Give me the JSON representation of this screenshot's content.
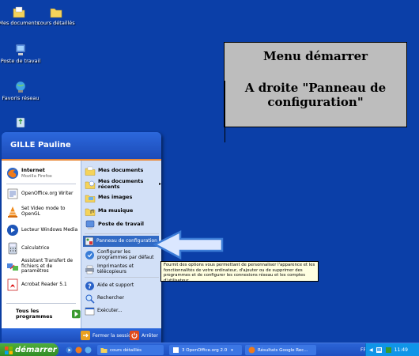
{
  "desktop": {
    "icons": [
      {
        "label": "Mes documents"
      },
      {
        "label": "cours détaillés"
      },
      {
        "label": "Poste de travail"
      },
      {
        "label": "Favoris réseau"
      }
    ]
  },
  "annotation": {
    "line1": "Menu démarrer",
    "line2": "A droite \"Panneau de configuration\""
  },
  "start_menu": {
    "user": "GILLE Pauline",
    "pinned": [
      {
        "title": "Internet",
        "subtitle": "Mozilla Firefox"
      }
    ],
    "recent": [
      {
        "label": "OpenOffice.org Writer"
      },
      {
        "label": "Set Video mode to OpenGL"
      },
      {
        "label": "Lecteur Windows Media"
      },
      {
        "label": "Calculatrice"
      },
      {
        "label": "Assistant Transfert de fichiers et de paramètres"
      },
      {
        "label": "Acrobat Reader 5.1"
      }
    ],
    "all_programs": "Tous les programmes",
    "right": {
      "mes_documents": "Mes documents",
      "documents_recents": "Mes documents récents",
      "mes_images": "Mes images",
      "ma_musique": "Ma musique",
      "poste_de_travail": "Poste de travail",
      "panneau": "Panneau de configuration",
      "configurer": "Configurer les programmes par défaut",
      "imprimantes": "Imprimantes et télécopieurs",
      "aide": "Aide et support",
      "rechercher": "Rechercher",
      "executer": "Exécuter..."
    },
    "footer": {
      "logoff": "Fermer la session",
      "shutdown": "Arrêter"
    }
  },
  "tooltip": "Fournit des options vous permettant de personnaliser l'apparence et les fonctionnalités de votre ordinateur, d'ajouter ou de supprimer des programmes et de configurer les connexions réseau et les comptes d'utilisateur.",
  "taskbar": {
    "start_label": "démarrer",
    "tasks": [
      {
        "label": "cours détaillés"
      },
      {
        "label": "3 OpenOffice.org 2.0"
      },
      {
        "label": "Résultats Google Rec..."
      }
    ],
    "lang": "FR",
    "clock": "11:49"
  },
  "colors": {
    "desktop": "#0b3fa8",
    "menu_blue": "#1f53c4",
    "menu_right": "#d2e0f7",
    "start_green": "#3a9a2e",
    "highlight": "#316ac5"
  }
}
